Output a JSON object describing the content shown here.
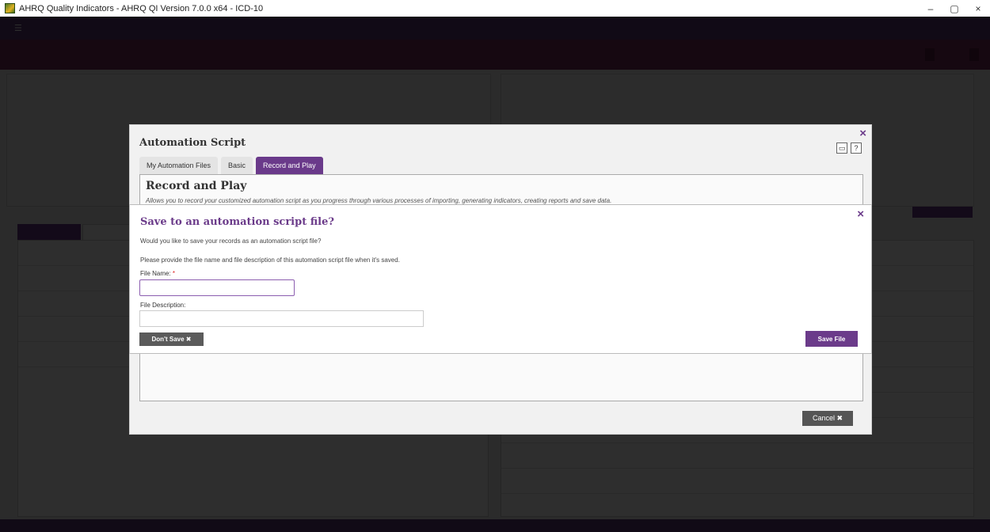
{
  "window": {
    "title": "AHRQ Quality Indicators - AHRQ QI Version 7.0.0 x64 - ICD-10",
    "minimize": "–",
    "maximize": "▢",
    "close": "×"
  },
  "automation_modal": {
    "title": "Automation Script",
    "close": "×",
    "tabs": [
      {
        "label": "My Automation Files"
      },
      {
        "label": "Basic"
      },
      {
        "label": "Record and Play"
      }
    ],
    "section_title": "Record and Play",
    "section_desc": "Allows you to record your customized automation script as you progress through various processes of importing, generating indicators, creating reports and save data.",
    "cancel": "Cancel ✖"
  },
  "save_dialog": {
    "title": "Save to an automation script file?",
    "close": "×",
    "question": "Would you like to save your records as an automation script file?",
    "hint": "Please provide the file name and file description of this automation script file when it's saved.",
    "file_name_label": "File Name:",
    "required_mark": "*",
    "file_name_value": "",
    "file_description_label": "File Description:",
    "file_description_value": "",
    "dont_save": "Don't Save ✖",
    "save_file": "Save File"
  },
  "colors": {
    "accent": "#6b3b8a",
    "required": "#dd2222"
  }
}
